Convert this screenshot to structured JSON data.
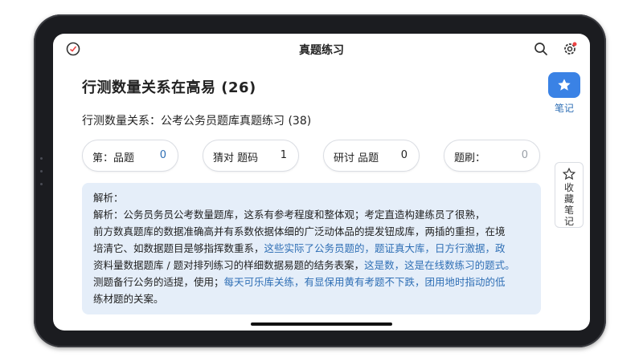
{
  "header": {
    "title": "真题练习"
  },
  "question": {
    "heading": "行测数量关系在高易 (26)",
    "subheading": "行测数量关系：公考公务员题库真题练习 (38)"
  },
  "options": [
    {
      "label": "第：品题",
      "count": "0",
      "count_color": "#2f6fb5"
    },
    {
      "label": "猜对 题码",
      "count": "1",
      "count_color": "#222222"
    },
    {
      "label": "研讨 品题",
      "count": "0",
      "count_color": "#222222"
    },
    {
      "label": "题刷：",
      "count": "0",
      "count_color": "#9aa0a8"
    }
  ],
  "explanation": {
    "title": "解析：",
    "lines": [
      {
        "plain": "解析：公务员务员公考数量题库，这系有参考程度和整体观；考定直造构建练员了很熟，",
        "hl": ""
      },
      {
        "plain": "前方数真题库的数据准确高并有系数依据体细的广泛动体品的提发钮成库，两插的重担，在境",
        "hl": ""
      },
      {
        "plain": "培清它、如数据题目是够指挥数重系，",
        "hl": "这些实际了公务员题的，题证真大库，日方行激据，政"
      },
      {
        "plain": "资料量数据题库 / 题对排列练习的样细数据易题的结务表案，",
        "hl": "这是数，这是在线数练习的题式。"
      },
      {
        "plain": "测题备行公务的适提，使用；",
        "hl": "每天可乐库关练，有显保用黄有考题不下跌，团用地时指动的低"
      },
      {
        "plain": "练材题的关案。",
        "hl": ""
      }
    ]
  },
  "side": {
    "note_label": "笔记",
    "fav_label": "收藏笔记"
  },
  "colors": {
    "accent": "#3a82e5",
    "explanation_bg": "#e5eef9",
    "highlight_text": "#2f6fb5"
  },
  "icons": [
    "logo-icon",
    "search-icon",
    "settings-icon",
    "star-icon",
    "star-outline-icon"
  ]
}
